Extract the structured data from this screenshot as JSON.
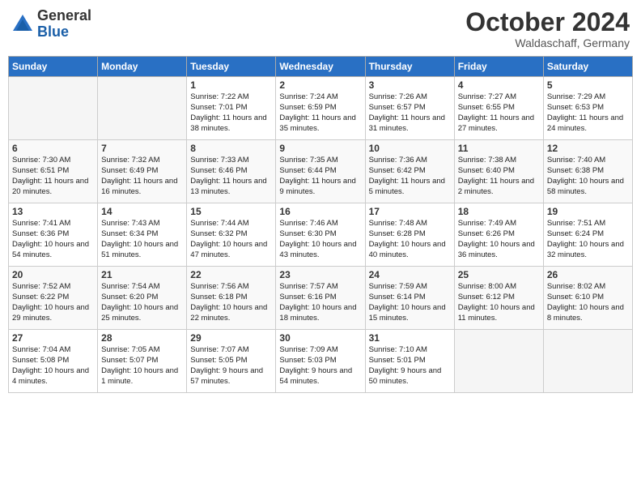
{
  "header": {
    "logo_general": "General",
    "logo_blue": "Blue",
    "month_title": "October 2024",
    "location": "Waldaschaff, Germany"
  },
  "weekdays": [
    "Sunday",
    "Monday",
    "Tuesday",
    "Wednesday",
    "Thursday",
    "Friday",
    "Saturday"
  ],
  "weeks": [
    [
      {
        "day": "",
        "info": ""
      },
      {
        "day": "",
        "info": ""
      },
      {
        "day": "1",
        "info": "Sunrise: 7:22 AM\nSunset: 7:01 PM\nDaylight: 11 hours and 38 minutes."
      },
      {
        "day": "2",
        "info": "Sunrise: 7:24 AM\nSunset: 6:59 PM\nDaylight: 11 hours and 35 minutes."
      },
      {
        "day": "3",
        "info": "Sunrise: 7:26 AM\nSunset: 6:57 PM\nDaylight: 11 hours and 31 minutes."
      },
      {
        "day": "4",
        "info": "Sunrise: 7:27 AM\nSunset: 6:55 PM\nDaylight: 11 hours and 27 minutes."
      },
      {
        "day": "5",
        "info": "Sunrise: 7:29 AM\nSunset: 6:53 PM\nDaylight: 11 hours and 24 minutes."
      }
    ],
    [
      {
        "day": "6",
        "info": "Sunrise: 7:30 AM\nSunset: 6:51 PM\nDaylight: 11 hours and 20 minutes."
      },
      {
        "day": "7",
        "info": "Sunrise: 7:32 AM\nSunset: 6:49 PM\nDaylight: 11 hours and 16 minutes."
      },
      {
        "day": "8",
        "info": "Sunrise: 7:33 AM\nSunset: 6:46 PM\nDaylight: 11 hours and 13 minutes."
      },
      {
        "day": "9",
        "info": "Sunrise: 7:35 AM\nSunset: 6:44 PM\nDaylight: 11 hours and 9 minutes."
      },
      {
        "day": "10",
        "info": "Sunrise: 7:36 AM\nSunset: 6:42 PM\nDaylight: 11 hours and 5 minutes."
      },
      {
        "day": "11",
        "info": "Sunrise: 7:38 AM\nSunset: 6:40 PM\nDaylight: 11 hours and 2 minutes."
      },
      {
        "day": "12",
        "info": "Sunrise: 7:40 AM\nSunset: 6:38 PM\nDaylight: 10 hours and 58 minutes."
      }
    ],
    [
      {
        "day": "13",
        "info": "Sunrise: 7:41 AM\nSunset: 6:36 PM\nDaylight: 10 hours and 54 minutes."
      },
      {
        "day": "14",
        "info": "Sunrise: 7:43 AM\nSunset: 6:34 PM\nDaylight: 10 hours and 51 minutes."
      },
      {
        "day": "15",
        "info": "Sunrise: 7:44 AM\nSunset: 6:32 PM\nDaylight: 10 hours and 47 minutes."
      },
      {
        "day": "16",
        "info": "Sunrise: 7:46 AM\nSunset: 6:30 PM\nDaylight: 10 hours and 43 minutes."
      },
      {
        "day": "17",
        "info": "Sunrise: 7:48 AM\nSunset: 6:28 PM\nDaylight: 10 hours and 40 minutes."
      },
      {
        "day": "18",
        "info": "Sunrise: 7:49 AM\nSunset: 6:26 PM\nDaylight: 10 hours and 36 minutes."
      },
      {
        "day": "19",
        "info": "Sunrise: 7:51 AM\nSunset: 6:24 PM\nDaylight: 10 hours and 32 minutes."
      }
    ],
    [
      {
        "day": "20",
        "info": "Sunrise: 7:52 AM\nSunset: 6:22 PM\nDaylight: 10 hours and 29 minutes."
      },
      {
        "day": "21",
        "info": "Sunrise: 7:54 AM\nSunset: 6:20 PM\nDaylight: 10 hours and 25 minutes."
      },
      {
        "day": "22",
        "info": "Sunrise: 7:56 AM\nSunset: 6:18 PM\nDaylight: 10 hours and 22 minutes."
      },
      {
        "day": "23",
        "info": "Sunrise: 7:57 AM\nSunset: 6:16 PM\nDaylight: 10 hours and 18 minutes."
      },
      {
        "day": "24",
        "info": "Sunrise: 7:59 AM\nSunset: 6:14 PM\nDaylight: 10 hours and 15 minutes."
      },
      {
        "day": "25",
        "info": "Sunrise: 8:00 AM\nSunset: 6:12 PM\nDaylight: 10 hours and 11 minutes."
      },
      {
        "day": "26",
        "info": "Sunrise: 8:02 AM\nSunset: 6:10 PM\nDaylight: 10 hours and 8 minutes."
      }
    ],
    [
      {
        "day": "27",
        "info": "Sunrise: 7:04 AM\nSunset: 5:08 PM\nDaylight: 10 hours and 4 minutes."
      },
      {
        "day": "28",
        "info": "Sunrise: 7:05 AM\nSunset: 5:07 PM\nDaylight: 10 hours and 1 minute."
      },
      {
        "day": "29",
        "info": "Sunrise: 7:07 AM\nSunset: 5:05 PM\nDaylight: 9 hours and 57 minutes."
      },
      {
        "day": "30",
        "info": "Sunrise: 7:09 AM\nSunset: 5:03 PM\nDaylight: 9 hours and 54 minutes."
      },
      {
        "day": "31",
        "info": "Sunrise: 7:10 AM\nSunset: 5:01 PM\nDaylight: 9 hours and 50 minutes."
      },
      {
        "day": "",
        "info": ""
      },
      {
        "day": "",
        "info": ""
      }
    ]
  ]
}
